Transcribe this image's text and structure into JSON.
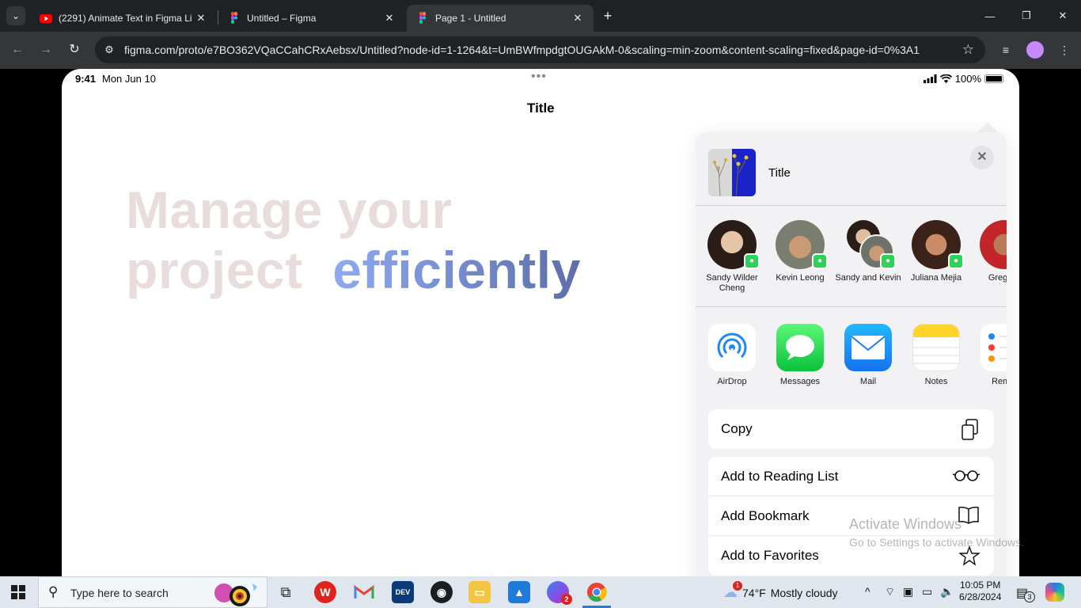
{
  "browser": {
    "tabs": [
      {
        "title": "(2291) Animate Text in Figma Li",
        "active": false
      },
      {
        "title": "Untitled – Figma",
        "active": false
      },
      {
        "title": "Page 1 - Untitled",
        "active": true
      }
    ],
    "url": "figma.com/proto/e7BO362VQaCCahCRxAebsx/Untitled?node-id=1-1264&t=UmBWfmpdgtOUGAkM-0&scaling=min-zoom&content-scaling=fixed&page-id=0%3A1"
  },
  "ipad": {
    "status": {
      "time": "9:41",
      "date": "Mon Jun 10",
      "battery": "100%"
    },
    "nav_title": "Title",
    "headline": {
      "line1": "Manage your",
      "line2_plain": "project",
      "line2_highlight": "efficiently"
    }
  },
  "share_sheet": {
    "title": "Title",
    "people": [
      {
        "name": "Sandy Wilder Cheng"
      },
      {
        "name": "Kevin Leong"
      },
      {
        "name": "Sandy and Kevin"
      },
      {
        "name": "Juliana Mejia"
      },
      {
        "name": "Greg Ap"
      }
    ],
    "apps": [
      {
        "name": "AirDrop",
        "icon": "airdrop-icon"
      },
      {
        "name": "Messages",
        "icon": "messages-icon"
      },
      {
        "name": "Mail",
        "icon": "mail-icon"
      },
      {
        "name": "Notes",
        "icon": "notes-icon"
      },
      {
        "name": "Remin",
        "icon": "reminders-icon"
      }
    ],
    "actions": [
      {
        "label": "Copy",
        "icon": "copy-icon"
      },
      {
        "label": "Add to Reading List",
        "icon": "glasses-icon"
      },
      {
        "label": "Add Bookmark",
        "icon": "book-icon"
      },
      {
        "label": "Add to Favorites",
        "icon": "star-icon"
      }
    ]
  },
  "watermark": {
    "line1": "Activate Windows",
    "line2": "Go to Settings to activate Windows."
  },
  "taskbar": {
    "search_placeholder": "Type here to search",
    "weather": {
      "temp": "74°F",
      "condition": "Mostly cloudy",
      "alert": "1"
    },
    "clock": {
      "time": "10:05 PM",
      "date": "6/28/2024"
    },
    "notifications": "3",
    "messenger_badge": "2"
  }
}
